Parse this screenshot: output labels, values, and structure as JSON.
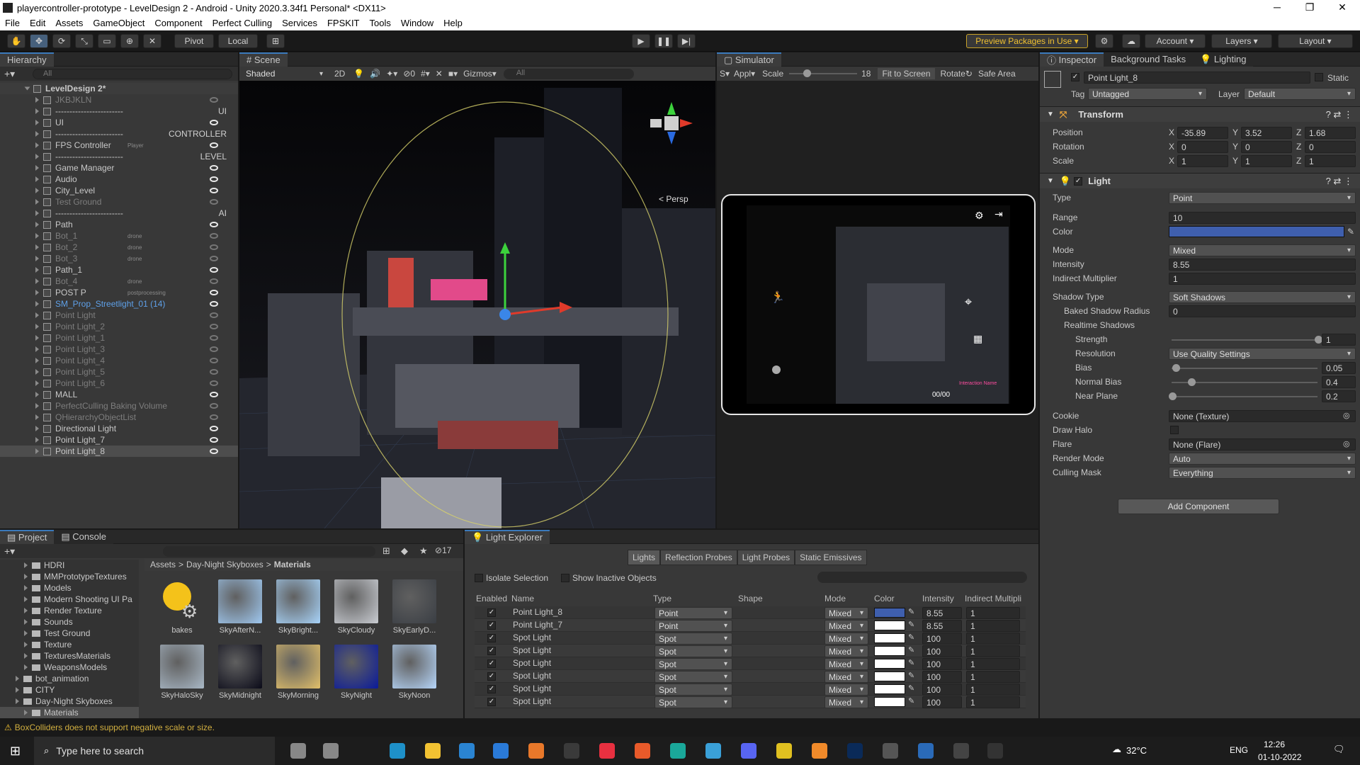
{
  "window": {
    "title": "playercontroller-prototype - LevelDesign 2 - Android - Unity 2020.3.34f1 Personal* <DX11>"
  },
  "menu": [
    "File",
    "Edit",
    "Assets",
    "GameObject",
    "Component",
    "Perfect Culling",
    "Services",
    "FPSKIT",
    "Tools",
    "Window",
    "Help"
  ],
  "toolbar": {
    "pivot": "Pivot",
    "local": "Local",
    "preview_packages": "Preview Packages in Use",
    "account": "Account",
    "layers": "Layers",
    "layout": "Layout"
  },
  "hierarchy": {
    "title": "Hierarchy",
    "search_placeholder": "All",
    "scene": "LevelDesign 2*",
    "items": [
      {
        "name": "JKBJKLN",
        "style": "dim",
        "tag": "",
        "extra": ""
      },
      {
        "name": "------------------------",
        "style": "",
        "tag": "",
        "extra": "UI"
      },
      {
        "name": "UI",
        "style": "",
        "tag": "",
        "extra": ""
      },
      {
        "name": "------------------------",
        "style": "",
        "tag": "",
        "extra": "CONTROLLER"
      },
      {
        "name": "FPS Controller",
        "style": "",
        "tag": "Player",
        "extra": ""
      },
      {
        "name": "------------------------",
        "style": "",
        "tag": "",
        "extra": "LEVEL"
      },
      {
        "name": "Game Manager",
        "style": "",
        "tag": "",
        "extra": ""
      },
      {
        "name": "Audio",
        "style": "",
        "tag": "",
        "extra": ""
      },
      {
        "name": "City_Level",
        "style": "",
        "tag": "",
        "extra": ""
      },
      {
        "name": "Test Ground",
        "style": "dim",
        "tag": "",
        "extra": ""
      },
      {
        "name": "------------------------",
        "style": "",
        "tag": "",
        "extra": "AI"
      },
      {
        "name": "Path",
        "style": "",
        "tag": "",
        "extra": ""
      },
      {
        "name": "Bot_1",
        "style": "dim",
        "tag": "drone",
        "extra": ""
      },
      {
        "name": "Bot_2",
        "style": "dim",
        "tag": "drone",
        "extra": ""
      },
      {
        "name": "Bot_3",
        "style": "dim",
        "tag": "drone",
        "extra": ""
      },
      {
        "name": "Path_1",
        "style": "",
        "tag": "",
        "extra": ""
      },
      {
        "name": "Bot_4",
        "style": "dim",
        "tag": "drone",
        "extra": ""
      },
      {
        "name": "POST P",
        "style": "",
        "tag": "postprocessing",
        "extra": ""
      },
      {
        "name": "SM_Prop_Streetlight_01 (14)",
        "style": "blue",
        "tag": "",
        "extra": ""
      },
      {
        "name": "Point Light",
        "style": "dim",
        "tag": "",
        "extra": ""
      },
      {
        "name": "Point Light_2",
        "style": "dim",
        "tag": "",
        "extra": ""
      },
      {
        "name": "Point Light_1",
        "style": "dim",
        "tag": "",
        "extra": ""
      },
      {
        "name": "Point Light_3",
        "style": "dim",
        "tag": "",
        "extra": ""
      },
      {
        "name": "Point Light_4",
        "style": "dim",
        "tag": "",
        "extra": ""
      },
      {
        "name": "Point Light_5",
        "style": "dim",
        "tag": "",
        "extra": ""
      },
      {
        "name": "Point Light_6",
        "style": "dim",
        "tag": "",
        "extra": ""
      },
      {
        "name": "MALL",
        "style": "",
        "tag": "",
        "extra": ""
      },
      {
        "name": "PerfectCulling Baking Volume",
        "style": "dim",
        "tag": "",
        "extra": ""
      },
      {
        "name": "QHierarchyObjectList",
        "style": "dim",
        "tag": "",
        "extra": ""
      },
      {
        "name": "Directional Light",
        "style": "",
        "tag": "",
        "extra": ""
      },
      {
        "name": "Point Light_7",
        "style": "",
        "tag": "",
        "extra": ""
      },
      {
        "name": "Point Light_8",
        "style": "",
        "tag": "",
        "extra": ""
      }
    ]
  },
  "scene": {
    "tab": "Scene",
    "shading": "Shaded",
    "mode2d": "2D",
    "gizmos": "Gizmos",
    "search_placeholder": "All",
    "persp": "< Persp",
    "hidden_count": "0"
  },
  "simulator": {
    "tab": "Simulator",
    "app": "Appl",
    "scale_label": "Scale",
    "scale_value": "18",
    "fit": "Fit to Screen",
    "rotate": "Rotate",
    "safe_area": "Safe Area",
    "hud_counter": "00/00",
    "hud_label": "Interaction Name"
  },
  "inspector": {
    "tabs": [
      "Inspector",
      "Background Tasks",
      "Lighting"
    ],
    "object_name": "Point Light_8",
    "static": "Static",
    "tag_label": "Tag",
    "tag": "Untagged",
    "layer_label": "Layer",
    "layer": "Default",
    "transform": {
      "title": "Transform",
      "position_label": "Position",
      "position": {
        "x": "-35.89",
        "y": "3.52",
        "z": "1.68"
      },
      "rotation_label": "Rotation",
      "rotation": {
        "x": "0",
        "y": "0",
        "z": "0"
      },
      "scale_label": "Scale",
      "scale": {
        "x": "1",
        "y": "1",
        "z": "1"
      }
    },
    "light": {
      "title": "Light",
      "fields": [
        {
          "label": "Type",
          "value": "Point",
          "kind": "dd"
        },
        {
          "label": "Range",
          "value": "10",
          "kind": "field"
        },
        {
          "label": "Color",
          "value": "",
          "kind": "color"
        },
        {
          "label": "Mode",
          "value": "Mixed",
          "kind": "dd"
        },
        {
          "label": "Intensity",
          "value": "8.55",
          "kind": "field"
        },
        {
          "label": "Indirect Multiplier",
          "value": "1",
          "kind": "field"
        },
        {
          "label": "Shadow Type",
          "value": "Soft Shadows",
          "kind": "dd"
        },
        {
          "label": "Baked Shadow Radius",
          "value": "0",
          "kind": "field"
        },
        {
          "label": "Realtime Shadows",
          "value": "",
          "kind": "none"
        },
        {
          "label": "Strength",
          "value": "1",
          "kind": "slider",
          "level": 1.0
        },
        {
          "label": "Resolution",
          "value": "Use Quality Settings",
          "kind": "dd"
        },
        {
          "label": "Bias",
          "value": "0.05",
          "kind": "slider",
          "level": 0.025
        },
        {
          "label": "Normal Bias",
          "value": "0.4",
          "kind": "slider",
          "level": 0.133
        },
        {
          "label": "Near Plane",
          "value": "0.2",
          "kind": "slider",
          "level": 0.0
        },
        {
          "label": "Cookie",
          "value": "None (Texture)",
          "kind": "obj"
        },
        {
          "label": "Draw Halo",
          "value": "",
          "kind": "check"
        },
        {
          "label": "Flare",
          "value": "None (Flare)",
          "kind": "obj"
        },
        {
          "label": "Render Mode",
          "value": "Auto",
          "kind": "dd"
        },
        {
          "label": "Culling Mask",
          "value": "Everything",
          "kind": "dd"
        }
      ],
      "color_hex": "#3f5fae"
    },
    "add_component": "Add Component"
  },
  "project": {
    "tabs": [
      "Project",
      "Console"
    ],
    "tree": [
      {
        "name": "HDRI",
        "indent": 1
      },
      {
        "name": "MMPrototypeTextures",
        "indent": 1
      },
      {
        "name": "Models",
        "indent": 1
      },
      {
        "name": "Modern Shooting UI Pa",
        "indent": 1
      },
      {
        "name": "Render Texture",
        "indent": 1
      },
      {
        "name": "Sounds",
        "indent": 1
      },
      {
        "name": "Test Ground",
        "indent": 1
      },
      {
        "name": "Texture",
        "indent": 1
      },
      {
        "name": "TexturesMaterials",
        "indent": 1
      },
      {
        "name": "WeaponsModels",
        "indent": 1
      },
      {
        "name": "bot_animation",
        "indent": 0
      },
      {
        "name": "CITY",
        "indent": 0
      },
      {
        "name": "Day-Night Skyboxes",
        "indent": 0
      },
      {
        "name": "Materials",
        "indent": 1
      }
    ],
    "breadcrumb": [
      "Assets",
      "Day-Night Skyboxes",
      "Materials"
    ],
    "hidden_count": "17",
    "assets": [
      "bakes",
      "SkyAfterN...",
      "SkyBright...",
      "SkyCloudy",
      "SkyEarlyD...",
      "SkyHaloSky",
      "SkyMidnight",
      "SkyMorning",
      "SkyNight",
      "SkyNoon"
    ]
  },
  "light_explorer": {
    "tab": "Light Explorer",
    "subtabs": [
      "Lights",
      "Reflection Probes",
      "Light Probes",
      "Static Emissives"
    ],
    "isolate": "Isolate Selection",
    "inactive": "Show Inactive Objects",
    "columns": [
      "Enabled",
      "Name",
      "Type",
      "Shape",
      "Mode",
      "Color",
      "Intensity",
      "Indirect Multipli"
    ],
    "rows": [
      {
        "name": "Point Light_8",
        "type": "Point",
        "mode": "Mixed",
        "color": "#3f5fae",
        "intensity": "8.55",
        "indirect": "1"
      },
      {
        "name": "Point Light_7",
        "type": "Point",
        "mode": "Mixed",
        "color": "#ffffff",
        "intensity": "8.55",
        "indirect": "1"
      },
      {
        "name": "Spot Light",
        "type": "Spot",
        "mode": "Mixed",
        "color": "#ffffff",
        "intensity": "100",
        "indirect": "1"
      },
      {
        "name": "Spot Light",
        "type": "Spot",
        "mode": "Mixed",
        "color": "#ffffff",
        "intensity": "100",
        "indirect": "1"
      },
      {
        "name": "Spot Light",
        "type": "Spot",
        "mode": "Mixed",
        "color": "#ffffff",
        "intensity": "100",
        "indirect": "1"
      },
      {
        "name": "Spot Light",
        "type": "Spot",
        "mode": "Mixed",
        "color": "#ffffff",
        "intensity": "100",
        "indirect": "1"
      },
      {
        "name": "Spot Light",
        "type": "Spot",
        "mode": "Mixed",
        "color": "#ffffff",
        "intensity": "100",
        "indirect": "1"
      },
      {
        "name": "Spot Light",
        "type": "Spot",
        "mode": "Mixed",
        "color": "#ffffff",
        "intensity": "100",
        "indirect": "1"
      }
    ]
  },
  "statusbar": {
    "message": "BoxColliders does not support negative scale or size."
  },
  "taskbar": {
    "search_placeholder": "Type here to search",
    "temperature": "32°C",
    "lang": "ENG",
    "time": "12:26",
    "date": "01-10-2022"
  }
}
